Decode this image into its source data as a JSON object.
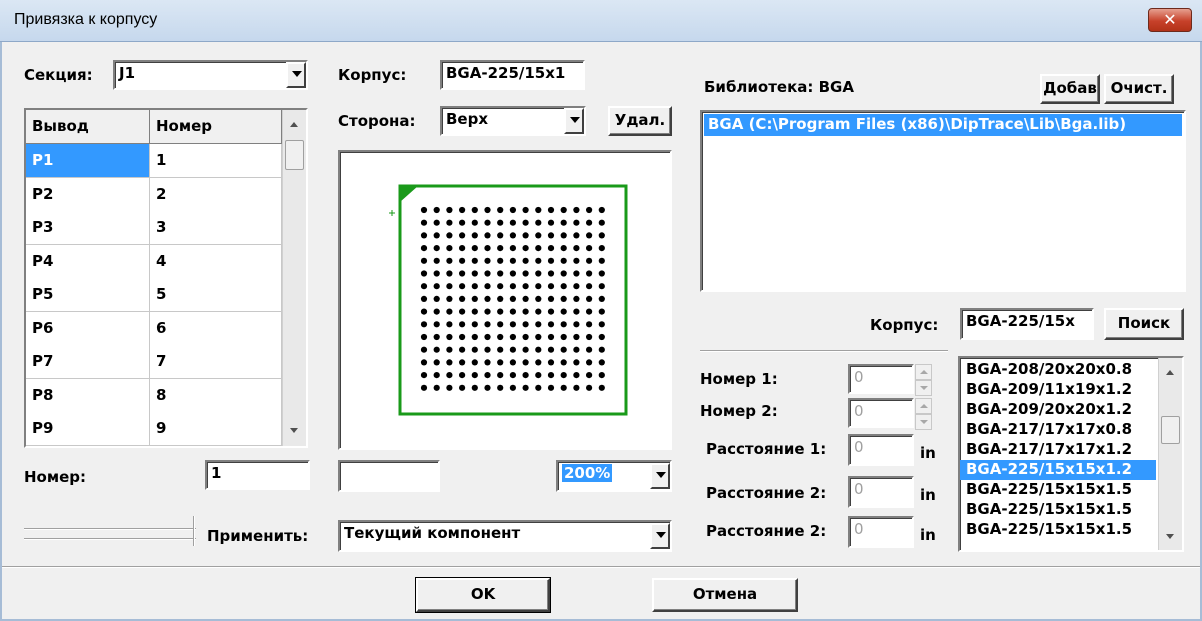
{
  "window": {
    "title": "Привязка к корпусу",
    "close_glyph": "✕"
  },
  "left": {
    "section_label": "Секция:",
    "section_value": "J1",
    "table_headers": [
      "Вывод",
      "Номер"
    ],
    "rows": [
      {
        "pin": "P1",
        "num": "1"
      },
      {
        "pin": "P2",
        "num": "2"
      },
      {
        "pin": "P3",
        "num": "3"
      },
      {
        "pin": "P4",
        "num": "4"
      },
      {
        "pin": "P5",
        "num": "5"
      },
      {
        "pin": "P6",
        "num": "6"
      },
      {
        "pin": "P7",
        "num": "7"
      },
      {
        "pin": "P8",
        "num": "8"
      },
      {
        "pin": "P9",
        "num": "9"
      }
    ],
    "number_label": "Номер:",
    "number_value": "1"
  },
  "middle": {
    "package_label": "Корпус:",
    "package_value": "BGA-225/15x1",
    "side_label": "Сторона:",
    "side_value": "Верх",
    "delete_label": "Удал.",
    "zoom_value": "200%",
    "extra_value": "",
    "apply_label": "Применить:",
    "apply_value": "Текущий компонент",
    "bga_grid_rows": 15,
    "bga_grid_cols": 15
  },
  "right": {
    "library_label": "Библиотека: BGA",
    "add_label": "Добав",
    "clear_label": "Очист.",
    "library_items": [
      "BGA (C:\\Program Files (x86)\\DipTrace\\Lib\\Bga.lib)"
    ],
    "package_label": "Корпус:",
    "package_value": "BGA-225/15x",
    "search_label": "Поиск",
    "number1_label": "Номер 1:",
    "number1_value": "0",
    "number2_label": "Номер 2:",
    "number2_value": "0",
    "dist1_label": "Расстояние 1:",
    "dist1_value": "0",
    "dist2_label": "Расстояние 2:",
    "dist2_value": "0",
    "dist3_label": "Расстояние 2:",
    "dist3_value": "0",
    "unit": "in",
    "packages": [
      "BGA-208/20x20x0.8",
      "BGA-209/11x19x1.2",
      "BGA-209/20x20x1.2",
      "BGA-217/17x17x0.8",
      "BGA-217/17x17x1.2",
      "BGA-225/15x15x1.2",
      "BGA-225/15x15x1.5",
      "BGA-225/15x15x1.5",
      "BGA-225/15x15x1.5"
    ],
    "selected_package_index": 5
  },
  "footer": {
    "ok_label": "OK",
    "cancel_label": "Отмена"
  },
  "colors": {
    "selection": "#3399ff",
    "outline_green": "#1a9a1a",
    "close_red": "#c7412a"
  }
}
